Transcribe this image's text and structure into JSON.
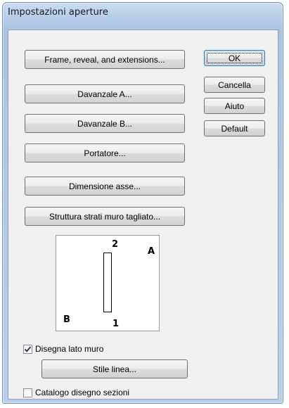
{
  "window": {
    "title": "Impostazioni aperture"
  },
  "left_buttons": [
    {
      "name": "frame-reveal-extensions-button",
      "label": "Frame, reveal, and extensions..."
    },
    {
      "name": "davanzale-a-button",
      "label": "Davanzale A..."
    },
    {
      "name": "davanzale-b-button",
      "label": "Davanzale B..."
    },
    {
      "name": "portatore-button",
      "label": "Portatore..."
    },
    {
      "name": "dimensione-asse-button",
      "label": "Dimensione asse..."
    },
    {
      "name": "struttura-strati-button",
      "label": "Struttura strati muro tagliato..."
    }
  ],
  "right_buttons": {
    "ok": "OK",
    "cancel": "Cancella",
    "help": "Aiuto",
    "default": "Default"
  },
  "diagram": {
    "label_2": "2",
    "label_a": "A",
    "label_b": "B",
    "label_1": "1"
  },
  "options": {
    "draw_wall_side": {
      "label": "Disegna lato muro",
      "checked": true
    },
    "line_style_button": "Stile linea...",
    "section_catalog": {
      "label": "Catalogo disegno sezioni",
      "checked": false
    }
  },
  "colors": {
    "titlebar": "#b5cde9",
    "dialog_face": "#f0f0f0",
    "check_mark": "#2b3f6b"
  }
}
